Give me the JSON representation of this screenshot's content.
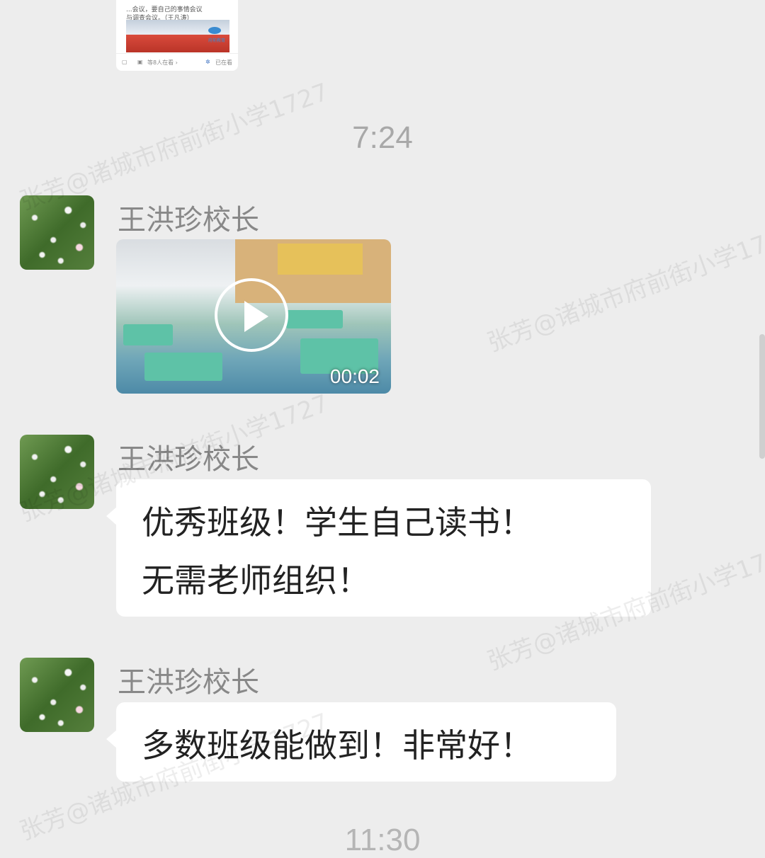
{
  "article_card": {
    "snippet_line1": "...会议，要自己的事情会议",
    "snippet_line2": "与调查会议。（王凡涛）",
    "img_logo_text": "府前教育",
    "footer_left": "等8人在看 ›",
    "footer_right": "已在看"
  },
  "timestamps": [
    "7:24",
    "11:30"
  ],
  "watermark": "张芳@诸城市府前街小学1727",
  "messages": [
    {
      "sender": "王洪珍校长",
      "type": "video",
      "duration": "00:02"
    },
    {
      "sender": "王洪珍校长",
      "type": "text",
      "line1": "优秀班级！学生自己读书！",
      "line2": "无需老师组织！"
    },
    {
      "sender": "王洪珍校长",
      "type": "text",
      "line1": "多数班级能做到！非常好！"
    }
  ],
  "colors": {
    "background": "#ededed",
    "bubble": "#ffffff",
    "name_text": "#888888"
  }
}
